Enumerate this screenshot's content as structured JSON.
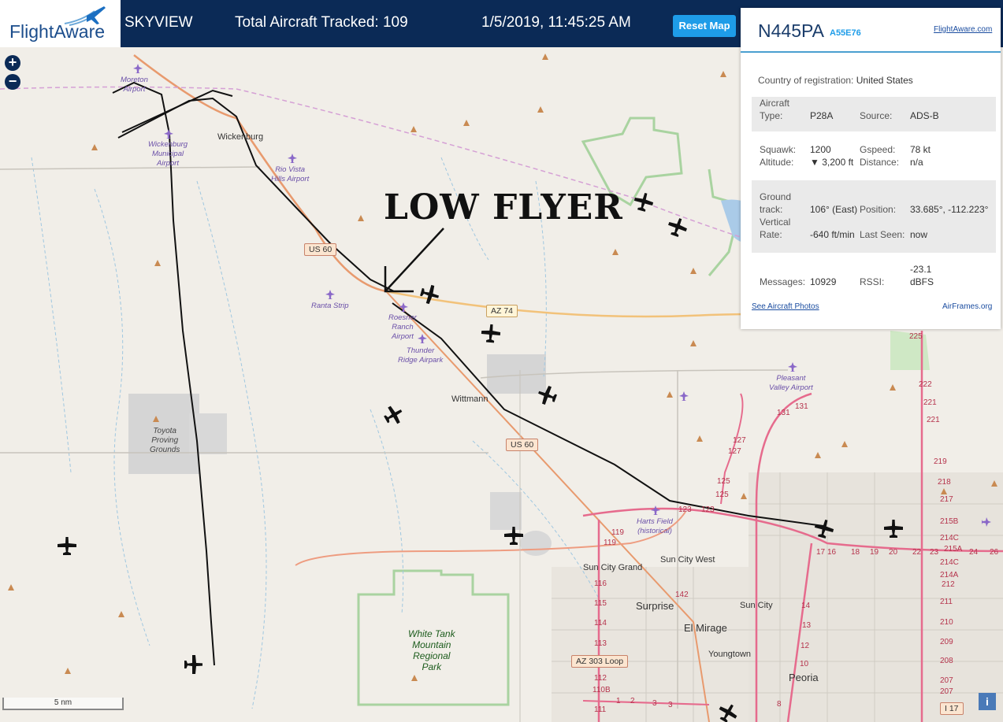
{
  "header": {
    "logo_text": "FlightAware",
    "app_name": "SKYVIEW",
    "aircraft_tracked": "Total Aircraft Tracked: 109",
    "datetime": "1/5/2019, 11:45:25 AM",
    "reset_button": "Reset Map"
  },
  "map": {
    "zoom_in": "+",
    "zoom_out": "−",
    "annotation": "LOW FLYER",
    "scale": "5 nm",
    "info_button": "i",
    "places": {
      "wickenburg": "Wickenburg",
      "wittmann": "Wittmann",
      "sun_city_grand": "Sun City Grand",
      "sun_city_west": "Sun City West",
      "surprise": "Surprise",
      "el_mirage": "El Mirage",
      "sun_city": "Sun City",
      "youngtown": "Youngtown",
      "peoria": "Peoria"
    },
    "airports": {
      "moreton": "Moreton\nAirport",
      "wickenburg_muni": "Wickenburg\nMunicipal\nAirport",
      "rio_vista": "Rio Vista\nHills Airport",
      "ranta": "Ranta Strip",
      "roesner": "Roesner\nRanch\nAirport",
      "thunder_ridge": "Thunder\nRidge Airpark",
      "pleasant_valley": "Pleasant\nValley Airport",
      "harts_field": "Harts Field\n(historical)"
    },
    "grounds": "Toyota\nProving\nGrounds",
    "park": "White Tank\nMountain\nRegional\nPark",
    "shields": {
      "us60a": "US 60",
      "us60b": "US 60",
      "az74": "AZ 74",
      "az303": "AZ 303 Loop",
      "i17": "I 17"
    },
    "road_numbers": [
      "225",
      "222",
      "221",
      "221",
      "219",
      "218",
      "217",
      "215B",
      "214C",
      "215A",
      "214C",
      "214A",
      "212",
      "211",
      "210",
      "209",
      "208",
      "207",
      "207",
      "131",
      "131",
      "127",
      "127",
      "125",
      "125",
      "123",
      "123",
      "119",
      "119",
      "116",
      "115",
      "114",
      "113",
      "112",
      "110B",
      "111",
      "142",
      "17",
      "16",
      "18",
      "19",
      "20",
      "22",
      "23",
      "24",
      "26",
      "14",
      "13",
      "12",
      "10",
      "8",
      "1",
      "2",
      "3",
      "3"
    ]
  },
  "panel": {
    "tail": "N445PA",
    "hex": "A55E76",
    "fa_link": "FlightAware.com",
    "country_label": "Country of registration:",
    "country_value": "United States",
    "type_label": "Aircraft\nType:",
    "type_value": "P28A",
    "source_label": "Source:",
    "source_value": "ADS-B",
    "squawk_label": "Squawk:",
    "squawk_value": "1200",
    "altitude_label": "Altitude:",
    "altitude_value": "▼ 3,200 ft",
    "gspeed_label": "Gspeed:",
    "gspeed_value": "78 kt",
    "distance_label": "Distance:",
    "distance_value": "n/a",
    "track_label": "Ground\ntrack:",
    "track_value": "106° (East)",
    "position_label": "Position:",
    "position_value": "33.685°, -112.223°",
    "vrate_label": "Vertical\nRate:",
    "vrate_value": "-640 ft/min",
    "lastseen_label": "Last Seen:",
    "lastseen_value": "now",
    "messages_label": "Messages:",
    "messages_value": "10929",
    "rssi_label": "RSSI:",
    "rssi_value": "-23.1\ndBFS",
    "photos_link": "See Aircraft Photos",
    "airframes_link": "AirFrames.org"
  }
}
